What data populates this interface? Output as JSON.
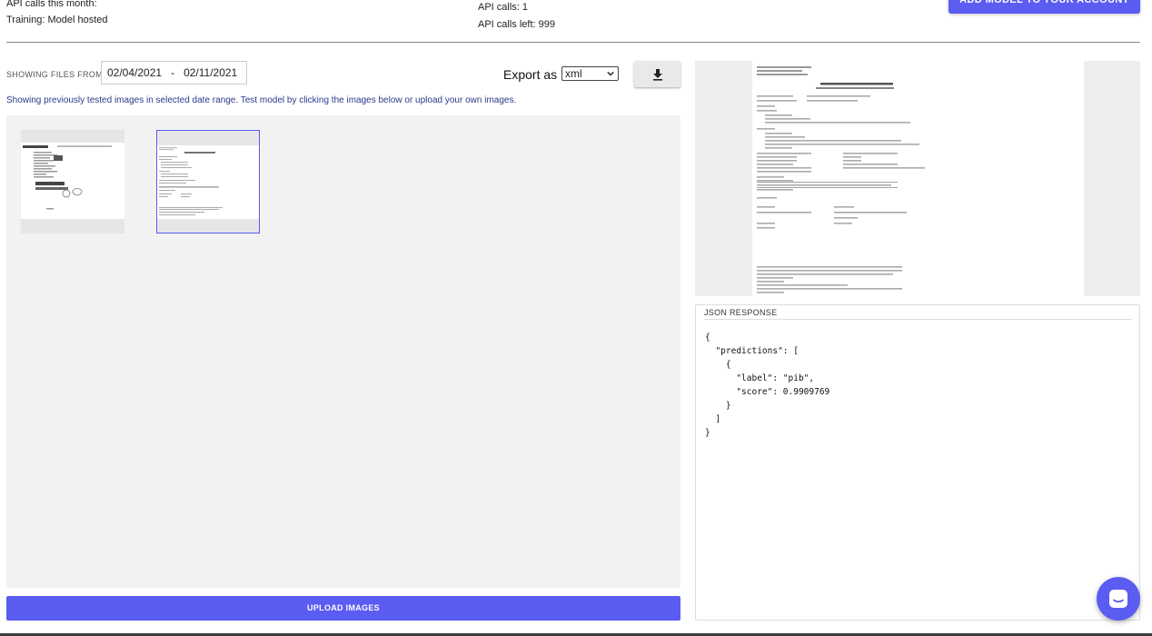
{
  "header": {
    "api_calls_month": "API calls this month:",
    "training": "Training: Model hosted",
    "api_calls": "API calls: 1",
    "api_calls_left": "API calls left: 999",
    "add_model_button": "ADD MODEL TO YOUR ACCOUNT"
  },
  "filters": {
    "showing_files_label": "SHOWING FILES FROM",
    "date_from": "02/04/2021",
    "date_separator": "-",
    "date_to": "02/11/2021",
    "export_label": "Export as",
    "export_format": "xml",
    "download_icon": "download-icon"
  },
  "info_text": "Showing previously tested images in selected date range. Test model by clicking the images below or upload your own images.",
  "gallery": {
    "thumbnails": [
      {
        "name": "document-thumbnail-1",
        "selected": false
      },
      {
        "name": "document-thumbnail-2",
        "selected": true
      }
    ]
  },
  "upload_button": "UPLOAD IMAGES",
  "json_panel": {
    "title": "JSON RESPONSE",
    "content": "{\n  \"predictions\": [\n    {\n      \"label\": \"pib\",\n      \"score\": 0.9909769\n    }\n  ]\n}"
  },
  "chat": {
    "icon": "chat-icon"
  },
  "colors": {
    "accent": "#5a5cf2",
    "gallery_bg": "#f2f2f2",
    "info_text": "#2a3a8a"
  }
}
